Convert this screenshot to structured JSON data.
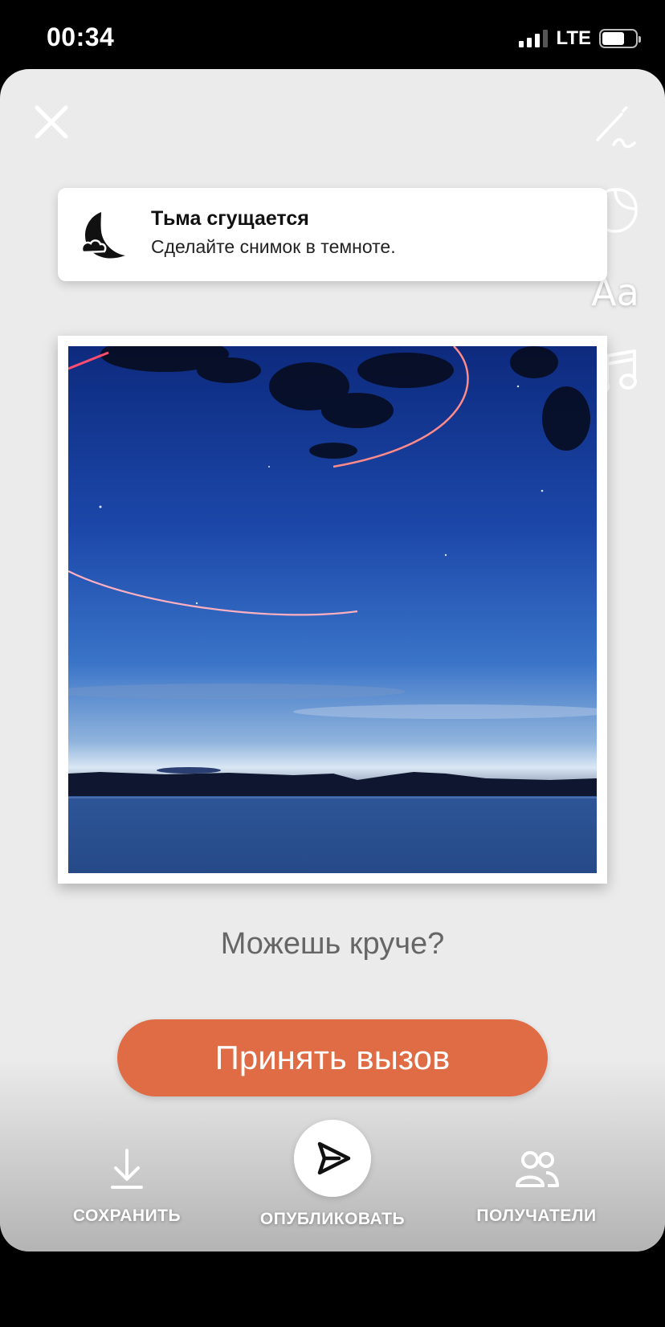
{
  "status_bar": {
    "time": "00:34",
    "network": "LTE"
  },
  "toolbar": {
    "close_icon": "close-icon",
    "draw_icon": "pen-draw-icon",
    "sticker_icon": "sticker-icon",
    "text_tool": "Aa",
    "music_icon": "music-note-icon"
  },
  "banner": {
    "icon": "moon-cloud-icon",
    "title": "Тьма сгущается",
    "subtitle": "Сделайте снимок в темноте."
  },
  "photo": {
    "description_icon": "night-sky-photo"
  },
  "question": "Можешь круче?",
  "cta_label": "Принять вызов",
  "actions": {
    "save_label": "СОХРАНИТЬ",
    "publish_label": "ОПУБЛИКОВАТЬ",
    "recipients_label": "ПОЛУЧАТЕЛИ"
  },
  "colors": {
    "accent": "#e06c46",
    "background": "#ebebeb"
  }
}
